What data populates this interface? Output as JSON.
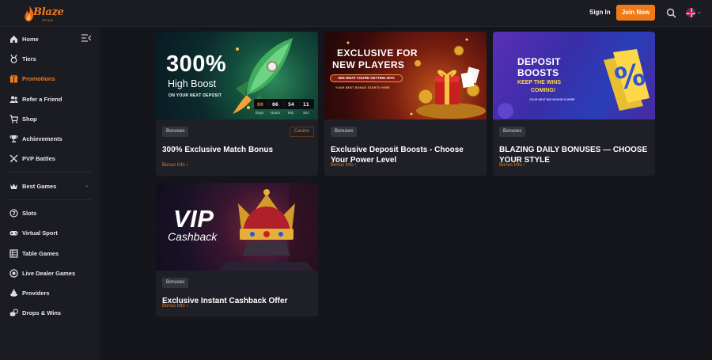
{
  "header": {
    "logo_text": "Blaze",
    "logo_sub": "SPINS",
    "signin_label": "Sign In",
    "join_label": "Join Now"
  },
  "sidebar": {
    "items": [
      {
        "label": "Home",
        "icon": "home-icon"
      },
      {
        "label": "Tiers",
        "icon": "medal-icon"
      },
      {
        "label": "Promotions",
        "icon": "gift-icon",
        "active": true
      },
      {
        "label": "Refer a Friend",
        "icon": "users-icon"
      },
      {
        "label": "Shop",
        "icon": "cart-icon"
      },
      {
        "label": "Achievements",
        "icon": "trophy-icon"
      },
      {
        "label": "PVP Battles",
        "icon": "swords-icon"
      },
      {
        "label": "Best Games",
        "icon": "crown-icon"
      },
      {
        "label": "Slots",
        "icon": "slots-icon"
      },
      {
        "label": "Virtual Sport",
        "icon": "gamepad-icon"
      },
      {
        "label": "Table Games",
        "icon": "table-icon"
      },
      {
        "label": "Live Dealer Games",
        "icon": "chip-icon"
      },
      {
        "label": "Providers",
        "icon": "providers-icon"
      },
      {
        "label": "Drops & Wins",
        "icon": "coins-icon"
      }
    ]
  },
  "promos": [
    {
      "title": "300% Exclusive Match Bonus",
      "tags": [
        "Bonuses",
        "Casino"
      ],
      "info": "Bonus Info",
      "banner": {
        "big": "300%",
        "line2": "High Boost",
        "line3": "ON YOUR NEXT DEPOSIT",
        "timer": [
          "00",
          "06",
          "54",
          "11"
        ],
        "timer_labels": [
          "Days",
          "Hours",
          "Min",
          "Sec"
        ]
      }
    },
    {
      "title": "Exclusive Deposit Boosts - Choose Your Power Level",
      "tags": [
        "Bonuses"
      ],
      "info": "Bonus Info",
      "banner": {
        "line1": "EXCLUSIVE FOR",
        "line2": "NEW PLAYERS",
        "button": "SEE WHAT YOU'RE GETTING INTO",
        "small": "YOUR BEST BONUS STARTS HERE"
      }
    },
    {
      "title": "BLAZING DAILY BONUSES — CHOOSE YOUR STYLE",
      "tags": [
        "Bonuses"
      ],
      "info": "Bonus Info",
      "banner": {
        "line1": "DEPOSIT",
        "line2": "BOOSTS",
        "line3": "KEEP THE WINS",
        "line4": "COMING!",
        "small": "YOUR NEXT BIG BONUS IS HERE",
        "symbol": "%"
      }
    },
    {
      "title": "Exclusive Instant Cashback Offer",
      "tags": [
        "Bonuses"
      ],
      "info": "Bonus Info",
      "banner": {
        "line1": "VIP",
        "line2": "Cashback"
      }
    }
  ],
  "colors": {
    "accent": "#ef7a17",
    "background": "#15151c",
    "panel": "#1b1b22",
    "card": "#1f1f27"
  }
}
